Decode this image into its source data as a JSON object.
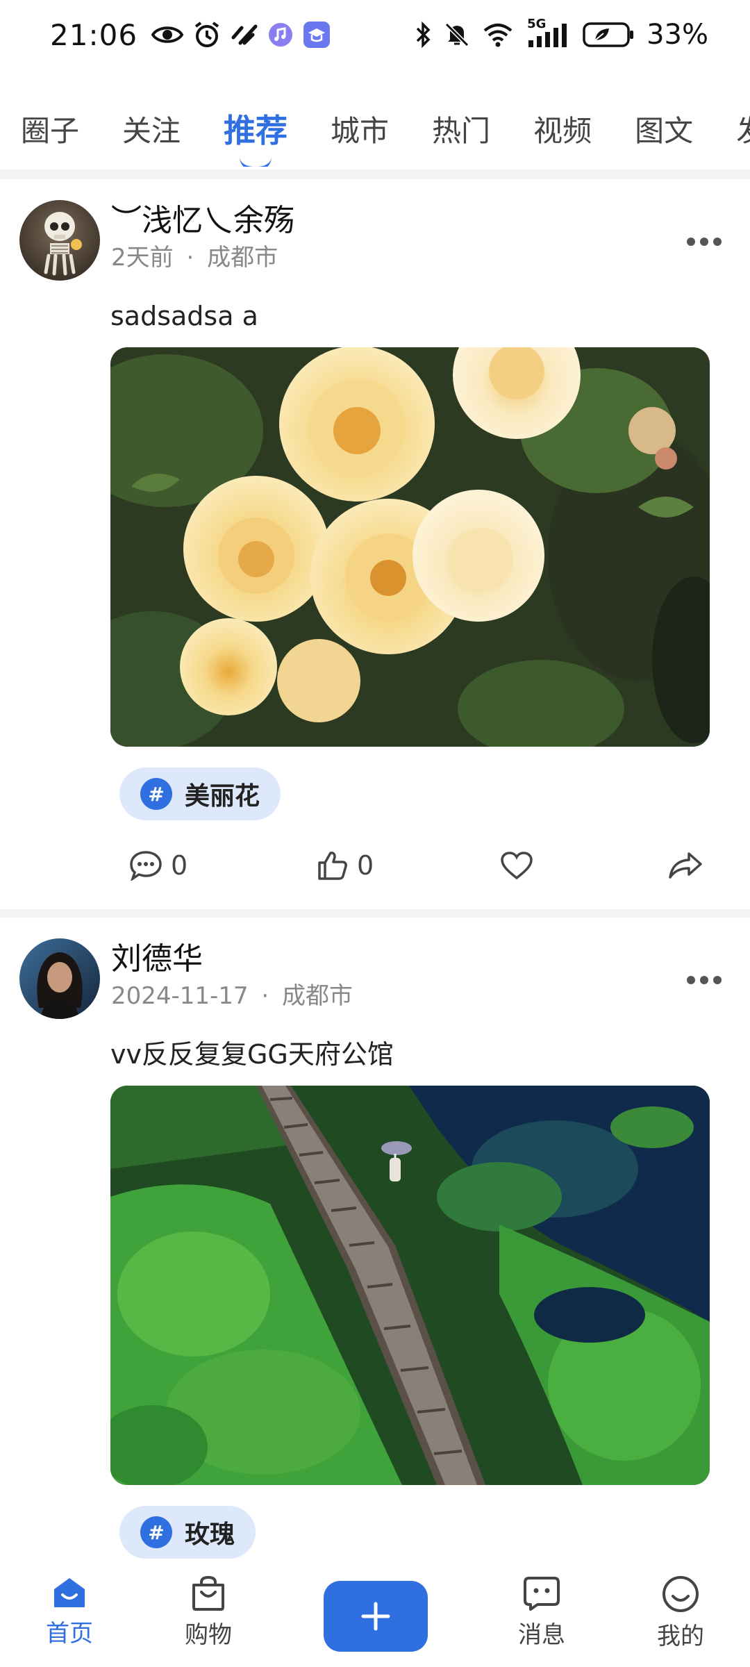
{
  "status_bar": {
    "time": "21:06",
    "left_icons": [
      "eye-icon",
      "alarm-icon",
      "app-icon",
      "music-icon",
      "education-app-icon"
    ],
    "right_icons": [
      "bluetooth-icon",
      "mute-icon",
      "wifi-icon",
      "signal-5g-icon",
      "battery-icon"
    ],
    "network_label": "5G",
    "battery": "33%"
  },
  "tabs": [
    {
      "label": "圈子",
      "active": false
    },
    {
      "label": "关注",
      "active": false
    },
    {
      "label": "推荐",
      "active": true
    },
    {
      "label": "城市",
      "active": false
    },
    {
      "label": "热门",
      "active": false
    },
    {
      "label": "视频",
      "active": false
    },
    {
      "label": "图文",
      "active": false
    },
    {
      "label": "发",
      "active": false
    }
  ],
  "posts": [
    {
      "author": "︶浅忆乀余殇",
      "time": "2天前",
      "location": "成都市",
      "separator": "·",
      "text": "sadsadsa a",
      "image_subject": "yellow roses",
      "topic": "美丽花",
      "comments": "0",
      "likes": "0"
    },
    {
      "author": "刘德华",
      "time": "2024-11-17",
      "location": "成都市",
      "separator": "·",
      "text": "vv反反复复GG天府公馆",
      "image_subject": "wooden boardwalk over lily pond",
      "topic": "玫瑰"
    }
  ],
  "bottom_nav": {
    "home": "首页",
    "shop": "购物",
    "publish_icon": "plus-icon",
    "messages": "消息",
    "me": "我的"
  },
  "colors": {
    "accent": "#2f6fe0",
    "tag_bg": "#dde8fb",
    "divider": "#f2f3f5",
    "meta_text": "#888888"
  }
}
